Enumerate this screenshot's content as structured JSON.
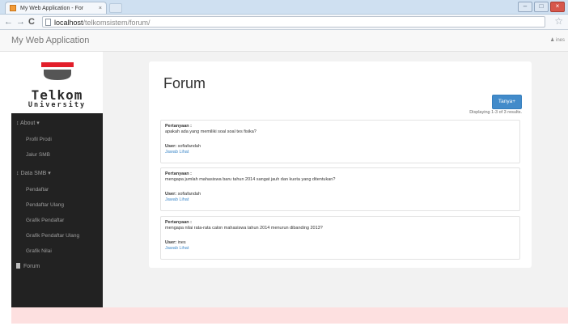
{
  "browser": {
    "tab_title": "My Web Application - For",
    "tab_close": "×",
    "url_host": "localhost",
    "url_path": "/telkomsistem/forum/",
    "win_minimize": "–",
    "win_maximize": "□",
    "win_close": "×"
  },
  "navbar": {
    "brand": "My Web Application",
    "user": "♟ ines"
  },
  "sidebar": {
    "logo_line1": "Telkom",
    "logo_line2": "University",
    "groups": [
      {
        "label": "↕ About ▾",
        "items": [
          "Profil Prodi",
          "Jalur SMB"
        ]
      },
      {
        "label": "↕ Data SMB ▾",
        "items": [
          "Pendaftar",
          "Pendaftar Ulang",
          "Grafik Pendaftar",
          "Grafik Pendaftar Ulang",
          "Grafik Nilai"
        ]
      }
    ],
    "forum_label": "Forum"
  },
  "main": {
    "title": "Forum",
    "ask_button": "Tanya+",
    "summary": "Displaying 1-3 of 3 results.",
    "question_label": "Pertanyaan :",
    "user_label": "User:",
    "link_answer": "Jawab",
    "link_view": "Lihat",
    "questions": [
      {
        "text": "apakah ada yang memiliki soal soal tes fisika?",
        "user": "sofiafandah"
      },
      {
        "text": "mengapa jumlah mahasiswa baru tahun 2014 sangat jauh dan kuota yang ditentukan?",
        "user": "sofiafandah"
      },
      {
        "text": "mengapa nilai rata-rata calon mahasiswa tahun 2014 menurun dibanding 2013?",
        "user": "ines"
      }
    ]
  },
  "colors": {
    "sidebar_bg": "#222222",
    "primary": "#428bca",
    "logo_red": "#e21e2a",
    "footer_pink": "#fde0e0"
  }
}
